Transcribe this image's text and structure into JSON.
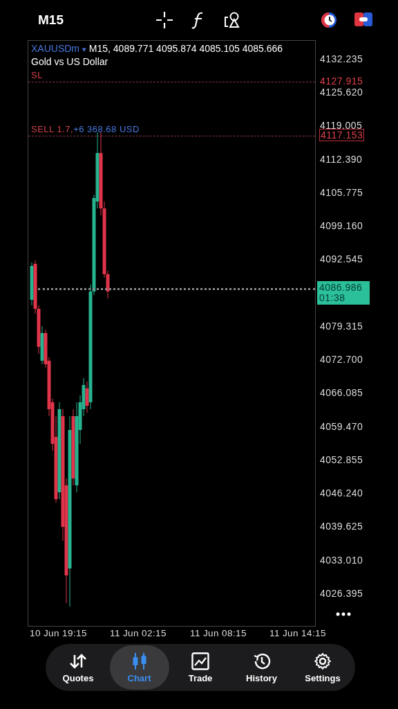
{
  "header": {
    "timeframe": "M15"
  },
  "chart": {
    "symbol": "XAUUSDm",
    "symbol_caret": "▾",
    "ohlc": "M15, 4089.771 4095.874 4085.105 4085.666",
    "description": "Gold vs US Dollar",
    "sl": {
      "label": "SL",
      "price": "4127.915"
    },
    "order": {
      "label": "SELL 1.7,",
      "profit": "+6 368.68 USD",
      "price": "4117.153"
    },
    "current": {
      "price": "4086.986",
      "timer": "01:38"
    },
    "price_ticks": [
      "4132.235",
      "4125.620",
      "4119.005",
      "4112.390",
      "4105.775",
      "4099.160",
      "4092.545",
      "4079.315",
      "4072.700",
      "4066.085",
      "4059.470",
      "4052.855",
      "4046.240",
      "4039.625",
      "4033.010",
      "4026.395"
    ],
    "time_labels": [
      "10 Jun 19:15",
      "11 Jun 02:15",
      "11 Jun 08:15",
      "11 Jun 14:15"
    ]
  },
  "nav": [
    {
      "label": "Quotes",
      "kind": "quotes",
      "selected": false
    },
    {
      "label": "Chart",
      "kind": "chart",
      "selected": true
    },
    {
      "label": "Trade",
      "kind": "trade",
      "selected": false
    },
    {
      "label": "History",
      "kind": "history",
      "selected": false
    },
    {
      "label": "Settings",
      "kind": "settings",
      "selected": false
    }
  ]
}
